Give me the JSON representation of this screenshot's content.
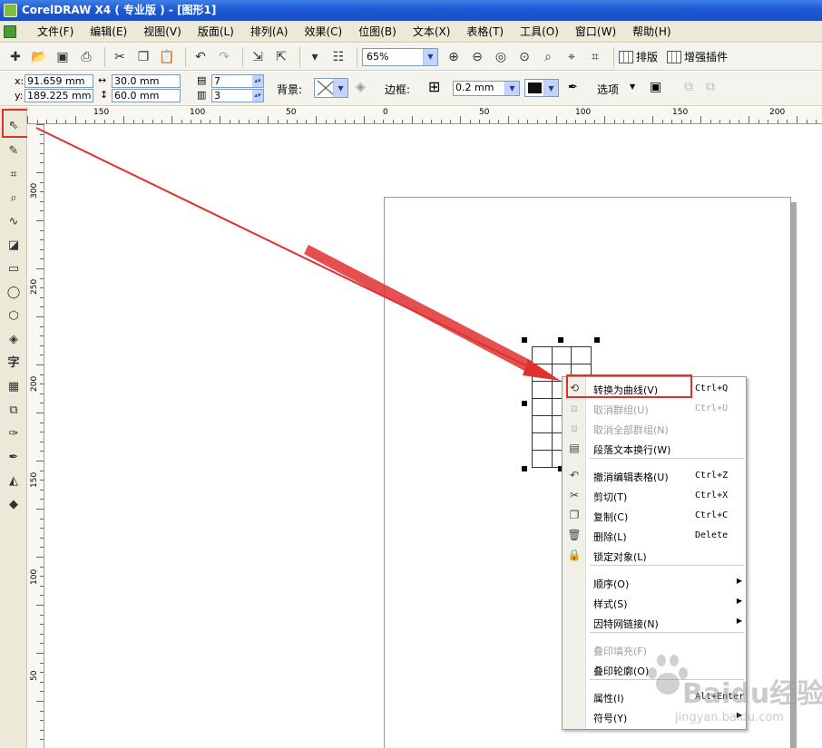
{
  "window": {
    "title": "CorelDRAW X4 ( 专业版 ) - [图形1]"
  },
  "menu": [
    "文件(F)",
    "编辑(E)",
    "视图(V)",
    "版面(L)",
    "排列(A)",
    "效果(C)",
    "位图(B)",
    "文本(X)",
    "表格(T)",
    "工具(O)",
    "窗口(W)",
    "帮助(H)"
  ],
  "toolbar": {
    "zoom": "65%",
    "layout_label": "排版",
    "plugin_label": "增强插件"
  },
  "propbar": {
    "x_label": "x:",
    "x_value": "91.659 mm",
    "y_label": "y:",
    "y_value": "189.225 mm",
    "w_value": "30.0 mm",
    "h_value": "60.0 mm",
    "rows": "7",
    "cols": "3",
    "bg_label": "背景:",
    "border_label": "边框:",
    "border_width": "0.2 mm",
    "options_label": "选项"
  },
  "ruler_top": [
    "150",
    "100",
    "50",
    "0",
    "50",
    "100",
    "150",
    "200"
  ],
  "ruler_left": [
    "300",
    "250",
    "200",
    "150",
    "100",
    "50"
  ],
  "context_menu": [
    {
      "icon": "convert-curves-icon",
      "label": "转换为曲线(V)",
      "shortcut": "Ctrl+Q",
      "enabled": true
    },
    {
      "icon": "ungroup-icon",
      "label": "取消群组(U)",
      "shortcut": "Ctrl+U",
      "enabled": false
    },
    {
      "icon": "ungroup-all-icon",
      "label": "取消全部群组(N)",
      "shortcut": "",
      "enabled": false
    },
    {
      "icon": "text-wrap-icon",
      "label": "段落文本换行(W)",
      "shortcut": "",
      "enabled": true
    },
    {
      "icon": "undo-icon",
      "label": "撤消编辑表格(U)",
      "shortcut": "Ctrl+Z",
      "enabled": true
    },
    {
      "icon": "cut-icon",
      "label": "剪切(T)",
      "shortcut": "Ctrl+X",
      "enabled": true
    },
    {
      "icon": "copy-icon",
      "label": "复制(C)",
      "shortcut": "Ctrl+C",
      "enabled": true
    },
    {
      "icon": "delete-icon",
      "label": "删除(L)",
      "shortcut": "Delete",
      "enabled": true
    },
    {
      "icon": "lock-icon",
      "label": "锁定对象(L)",
      "shortcut": "",
      "enabled": true
    },
    {
      "icon": "",
      "label": "顺序(O)",
      "shortcut": "",
      "enabled": true,
      "submenu": true
    },
    {
      "icon": "",
      "label": "样式(S)",
      "shortcut": "",
      "enabled": true,
      "submenu": true
    },
    {
      "icon": "",
      "label": "因特网链接(N)",
      "shortcut": "",
      "enabled": true,
      "submenu": true
    },
    {
      "icon": "",
      "label": "叠印填充(F)",
      "shortcut": "",
      "enabled": false
    },
    {
      "icon": "",
      "label": "叠印轮廓(O)",
      "shortcut": "",
      "enabled": true
    },
    {
      "icon": "",
      "label": "属性(I)",
      "shortcut": "Alt+Enter",
      "enabled": true
    },
    {
      "icon": "",
      "label": "符号(Y)",
      "shortcut": "",
      "enabled": true,
      "submenu": true
    }
  ],
  "watermark": {
    "brand": "Baidu经验",
    "url": "jingyan.baidu.com"
  },
  "colors": {
    "highlight": "#e03030",
    "titlebar": "#1d5ad6"
  }
}
